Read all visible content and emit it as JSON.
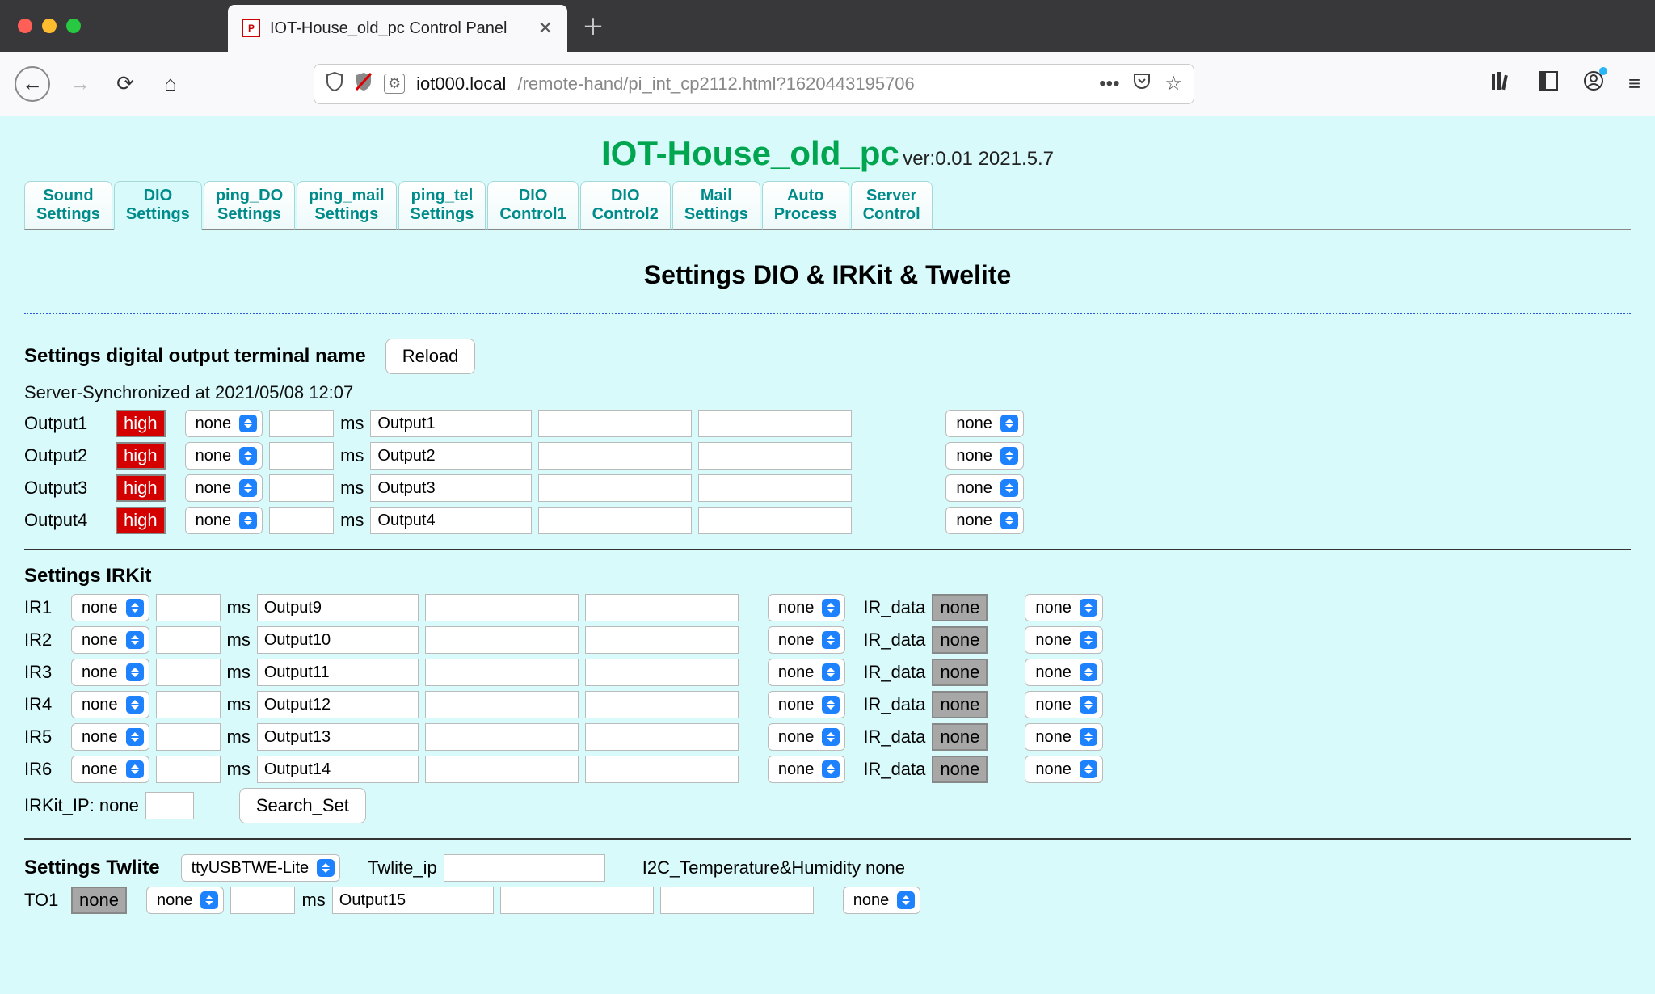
{
  "browser": {
    "tab_title": "IOT-House_old_pc Control Panel",
    "url_host": "iot000.local",
    "url_path": "/remote-hand/pi_int_cp2112.html?1620443195706"
  },
  "header": {
    "title": "IOT-House_old_pc",
    "version": "ver:0.01 2021.5.7"
  },
  "tabs": [
    "Sound\nSettings",
    "DIO\nSettings",
    "ping_DO\nSettings",
    "ping_mail\nSettings",
    "ping_tel\nSettings",
    "DIO\nControl1",
    "DIO\nControl2",
    "Mail\nSettings",
    "Auto\nProcess",
    "Server\nControl"
  ],
  "active_tab_index": 1,
  "panel_heading": "Settings DIO & IRKit & Twelite",
  "dout": {
    "section_title": "Settings digital output terminal name",
    "reload_label": "Reload",
    "sync_text": "Server-Synchronized at 2021/05/08 12:07",
    "rows": [
      {
        "label": "Output1",
        "state": "high",
        "sel1": "none",
        "msval": "",
        "name": "Output1",
        "f1": "",
        "f2": "",
        "sel2": "none"
      },
      {
        "label": "Output2",
        "state": "high",
        "sel1": "none",
        "msval": "",
        "name": "Output2",
        "f1": "",
        "f2": "",
        "sel2": "none"
      },
      {
        "label": "Output3",
        "state": "high",
        "sel1": "none",
        "msval": "",
        "name": "Output3",
        "f1": "",
        "f2": "",
        "sel2": "none"
      },
      {
        "label": "Output4",
        "state": "high",
        "sel1": "none",
        "msval": "",
        "name": "Output4",
        "f1": "",
        "f2": "",
        "sel2": "none"
      }
    ]
  },
  "irkit": {
    "section_title": "Settings IRKit",
    "rows": [
      {
        "label": "IR1",
        "sel1": "none",
        "msval": "",
        "name": "Output9",
        "f1": "",
        "f2": "",
        "sel2": "none",
        "irdata_label": "IR_data",
        "irdata_val": "none",
        "sel3": "none"
      },
      {
        "label": "IR2",
        "sel1": "none",
        "msval": "",
        "name": "Output10",
        "f1": "",
        "f2": "",
        "sel2": "none",
        "irdata_label": "IR_data",
        "irdata_val": "none",
        "sel3": "none"
      },
      {
        "label": "IR3",
        "sel1": "none",
        "msval": "",
        "name": "Output11",
        "f1": "",
        "f2": "",
        "sel2": "none",
        "irdata_label": "IR_data",
        "irdata_val": "none",
        "sel3": "none"
      },
      {
        "label": "IR4",
        "sel1": "none",
        "msval": "",
        "name": "Output12",
        "f1": "",
        "f2": "",
        "sel2": "none",
        "irdata_label": "IR_data",
        "irdata_val": "none",
        "sel3": "none"
      },
      {
        "label": "IR5",
        "sel1": "none",
        "msval": "",
        "name": "Output13",
        "f1": "",
        "f2": "",
        "sel2": "none",
        "irdata_label": "IR_data",
        "irdata_val": "none",
        "sel3": "none"
      },
      {
        "label": "IR6",
        "sel1": "none",
        "msval": "",
        "name": "Output14",
        "f1": "",
        "f2": "",
        "sel2": "none",
        "irdata_label": "IR_data",
        "irdata_val": "none",
        "sel3": "none"
      }
    ],
    "ip_label": "IRKit_IP: none",
    "search_btn": "Search_Set"
  },
  "twlite": {
    "section_title": "Settings Twlite",
    "port_sel": "ttyUSBTWE-Lite",
    "ip_label": "Twlite_ip",
    "ip_val": "",
    "i2c_label": "I2C_Temperature&Humidity none",
    "rows": [
      {
        "label": "TO1",
        "state": "none",
        "sel1": "none",
        "msval": "",
        "name": "Output15",
        "f1": "",
        "f2": "",
        "sel2": "none"
      }
    ]
  },
  "ms_label": "ms"
}
